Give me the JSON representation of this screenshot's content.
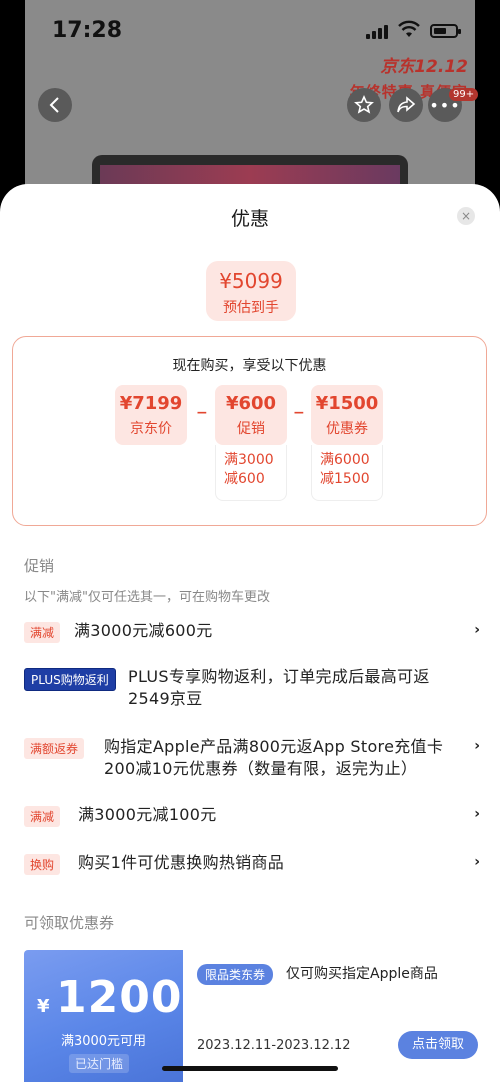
{
  "status_bar": {
    "time": "17:28"
  },
  "background_page": {
    "promo_line1": "京东12.12",
    "promo_line2": "年终特惠 真便宜",
    "cart_badge": "99+"
  },
  "sheet": {
    "title": "优惠",
    "close_icon": "×",
    "estimate": {
      "price": "¥5099",
      "label": "预估到手"
    },
    "breakdown": {
      "title": "现在购买，享受以下优惠",
      "items": [
        {
          "value": "¥7199",
          "label": "京东价"
        },
        {
          "value": "¥600",
          "label": "促销",
          "cond1": "满3000",
          "cond2": "减600"
        },
        {
          "value": "¥1500",
          "label": "优惠券",
          "cond1": "满6000",
          "cond2": "减1500"
        }
      ],
      "operator": "−"
    },
    "promotions": {
      "title": "促销",
      "note": "以下\"满减\"仅可任选其一，可在购物车更改",
      "items": [
        {
          "tag": "满减",
          "text": "满3000元减600元",
          "has_arrow": true
        },
        {
          "tag": "PLUS购物返利",
          "text1": "PLUS专享购物返利，订单完成后最高可返",
          "text2": "2549京豆",
          "has_arrow": false
        },
        {
          "tag": "满额返券",
          "text1": "购指定Apple产品满800元返App Store充值卡",
          "text2": "200减10元优惠券（数量有限，返完为止）",
          "has_arrow": true
        },
        {
          "tag": "满减",
          "text": "满3000元减100元",
          "has_arrow": true
        },
        {
          "tag": "换购",
          "text": "购买1件可优惠换购热销商品",
          "has_arrow": true
        }
      ],
      "arrow_glyph": "›"
    },
    "coupons": {
      "title": "可领取优惠券",
      "items": [
        {
          "currency": "¥",
          "amount": "1200",
          "condition": "满3000元可用",
          "threshold_status": "已达门槛",
          "category": "限品类东券",
          "description": "仅可购买指定Apple商品",
          "validity": "2023.12.11-2023.12.12",
          "action": "点击领取"
        }
      ]
    }
  },
  "colors": {
    "accent": "#e2462f",
    "accent_bg": "#fde6e2",
    "coupon_blue": "#5b82e0"
  }
}
